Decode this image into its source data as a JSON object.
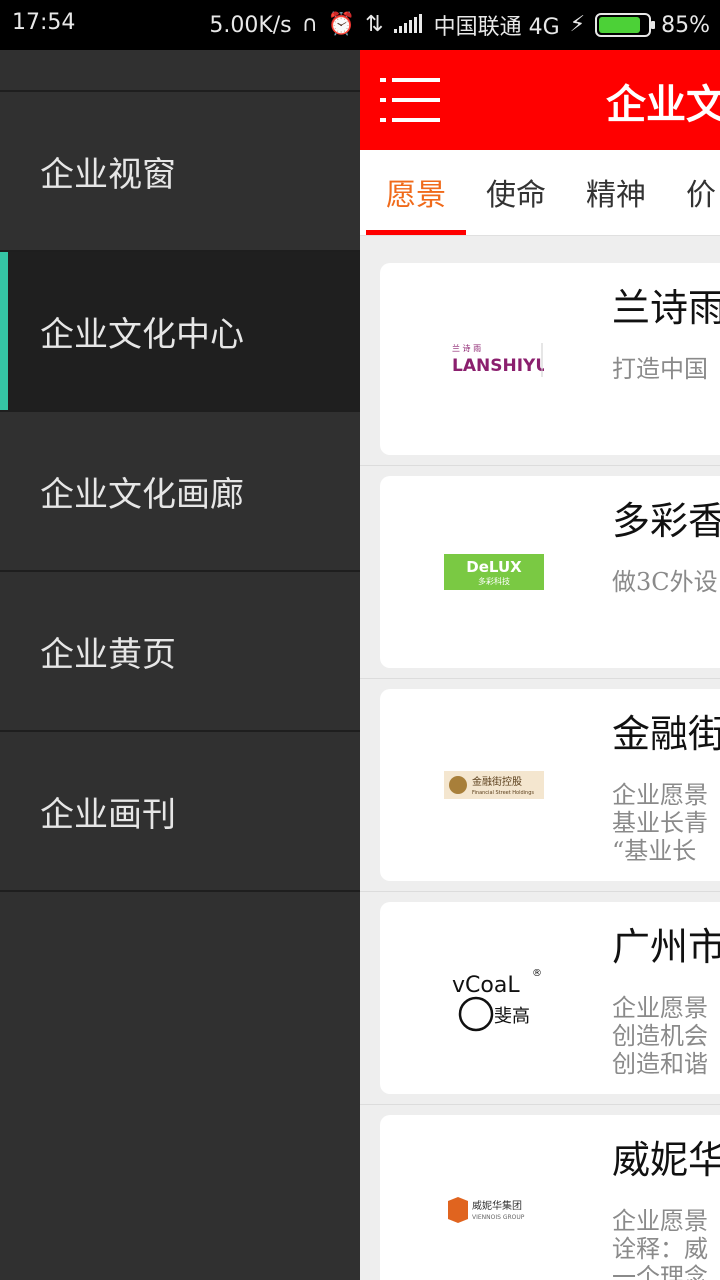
{
  "status_bar": {
    "time": "17:54",
    "speed": "5.00K/s",
    "carrier": "中国联通 4G",
    "battery": "85%",
    "battery_level": 0.85,
    "icons": [
      "headset-icon",
      "alarm-icon",
      "data-transfer-icon",
      "signal-icon",
      "charging-icon",
      "battery-icon"
    ]
  },
  "drawer": {
    "items": [
      {
        "label": "企业视窗"
      },
      {
        "label": "企业文化中心",
        "active": true
      },
      {
        "label": "企业文化画廊"
      },
      {
        "label": "企业黄页"
      },
      {
        "label": "企业画刊"
      }
    ]
  },
  "header": {
    "title": "企业文",
    "bg_color": "#ff0000"
  },
  "tabs": [
    "愿景",
    "使命",
    "精神",
    "价值"
  ],
  "tabs_visible": [
    "愿景",
    "使命",
    "精神",
    "价"
  ],
  "companies": [
    {
      "name": "兰诗雨",
      "logo_text": "LANSHIYU",
      "logo_sub": "兰 诗 雨",
      "desc": [
        "",
        "打造中国"
      ]
    },
    {
      "name": "多彩香",
      "logo_text": "DeLUX",
      "logo_sub": "多彩科技",
      "desc": [
        "",
        "做3C外设"
      ]
    },
    {
      "name": "金融街",
      "logo_text": "金融街控股",
      "logo_sub": "Financial Street Holdings",
      "desc": [
        "企业愿景",
        "基业长青",
        "“基业长"
      ]
    },
    {
      "name": "广州市",
      "logo_text": "vCoaL",
      "logo_sub": "斐高",
      "desc": [
        "企业愿景",
        "创造机会",
        "创造和谐"
      ]
    },
    {
      "name": "威妮华",
      "logo_text": "威妮华集团",
      "logo_sub": "VIENNOIS GROUP",
      "desc": [
        "企业愿景",
        "诠释：威",
        "一个理念"
      ]
    }
  ],
  "accent_colors": {
    "active_tab": "#f06a1a",
    "drawer_indicator": "#35c5a5"
  }
}
